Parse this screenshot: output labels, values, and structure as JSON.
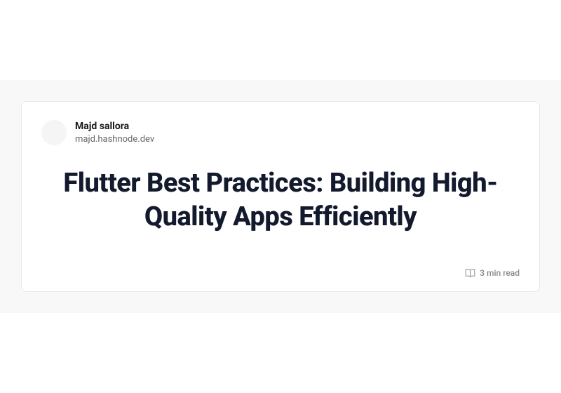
{
  "author": {
    "name": "Majd sallora",
    "domain": "majd.hashnode.dev"
  },
  "article": {
    "title": "Flutter Best Practices: Building High-Quality Apps Efficiently"
  },
  "meta": {
    "read_time": "3 min read"
  }
}
